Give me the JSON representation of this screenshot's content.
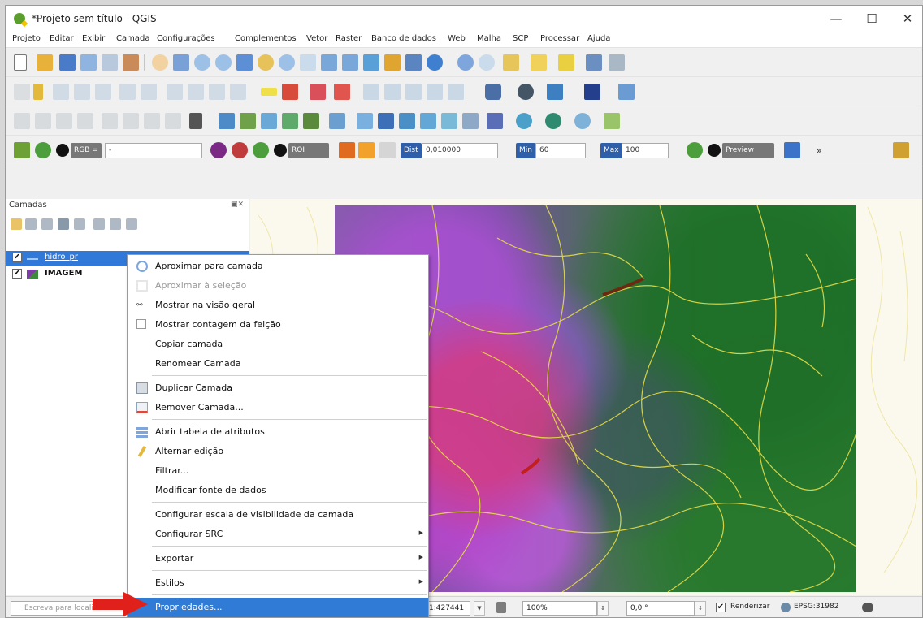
{
  "window": {
    "title": "*Projeto sem título - QGIS",
    "controls": {
      "minimize": "—",
      "maximize": "☐",
      "close": "✕"
    }
  },
  "menubar": [
    "Projeto",
    "Editar",
    "Exibir",
    "Camada",
    "Configurações",
    "Complementos",
    "Vetor",
    "Raster",
    "Banco de dados",
    "Web",
    "Malha",
    "SCP",
    "Processar",
    "Ajuda"
  ],
  "scp_toolbar": {
    "rgb_label": "RGB =",
    "rgb_value": "-",
    "roi_label": "ROI",
    "dist_label": "Dist",
    "dist_value": "0,010000",
    "min_label": "Min",
    "min_value": "60",
    "max_label": "Max",
    "max_value": "100",
    "preview_label": "Preview",
    "overflow": "»"
  },
  "layers_panel": {
    "title": "Camadas",
    "layers": [
      {
        "name": "hidro_pr",
        "checked": "✔",
        "selected": true
      },
      {
        "name": "IMAGEM",
        "checked": "✔",
        "selected": false
      }
    ]
  },
  "context_menu": {
    "items": [
      {
        "label": "Aproximar para camada",
        "icon": "zoom-to-layer-icon",
        "enabled": true
      },
      {
        "label": "Aproximar à seleção",
        "icon": "zoom-to-selection-icon",
        "enabled": false
      },
      {
        "label": "Mostrar na visão geral",
        "icon": "overview-icon",
        "enabled": true
      },
      {
        "label": "Mostrar contagem da feição",
        "icon": "feature-count-checkbox",
        "enabled": true
      },
      {
        "label": "Copiar camada",
        "icon": "",
        "enabled": true
      },
      {
        "label": "Renomear Camada",
        "icon": "",
        "enabled": true
      },
      {
        "label": "Duplicar Camada",
        "icon": "duplicate-layer-icon",
        "enabled": true
      },
      {
        "label": "Remover Camada...",
        "icon": "remove-layer-icon",
        "enabled": true
      },
      {
        "label": "Abrir tabela de atributos",
        "icon": "attribute-table-icon",
        "enabled": true
      },
      {
        "label": "Alternar edição",
        "icon": "pencil-icon",
        "enabled": true
      },
      {
        "label": "Filtrar...",
        "icon": "",
        "enabled": true
      },
      {
        "label": "Modificar fonte de dados",
        "icon": "",
        "enabled": true
      },
      {
        "label": "Configurar escala de visibilidade da camada",
        "icon": "",
        "enabled": true
      },
      {
        "label": "Configurar SRC",
        "icon": "",
        "enabled": true,
        "submenu": true
      },
      {
        "label": "Exportar",
        "icon": "",
        "enabled": true,
        "submenu": true
      },
      {
        "label": "Estilos",
        "icon": "",
        "enabled": true,
        "submenu": true
      },
      {
        "label": "Propriedades...",
        "icon": "",
        "enabled": true,
        "highlighted": true
      }
    ]
  },
  "statusbar": {
    "search_placeholder": "Escreva para localizar",
    "scale": "1:427441",
    "magnifier": "100%",
    "rotation": "0,0 °",
    "render_label": "Renderizar",
    "render_checked": "✔",
    "crs": "EPSG:31982"
  },
  "colors": {
    "selection": "#3079d9",
    "menu_highlight": "#2f7bd6",
    "arrow": "#e0201b",
    "rivers": "#e8e04a"
  }
}
